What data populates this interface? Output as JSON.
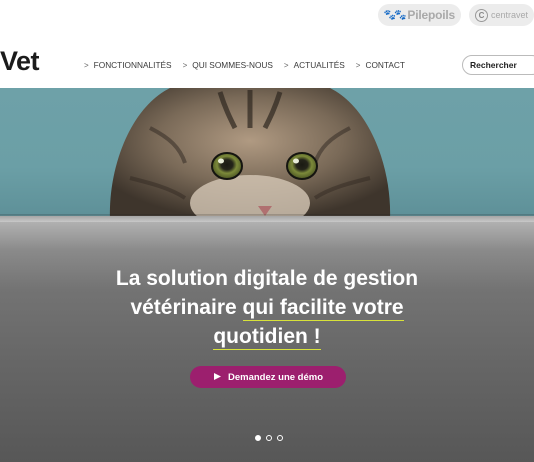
{
  "partners": {
    "pilepoils": "Pilepoils",
    "centravet": "centravet",
    "paw_icons": "🐾🐾"
  },
  "header": {
    "logo": "Vet",
    "nav": [
      {
        "label": "FONCTIONNALITÉS"
      },
      {
        "label": "QUI SOMMES-NOUS"
      },
      {
        "label": "ACTUALITÉS"
      },
      {
        "label": "CONTACT"
      }
    ],
    "chevron": ">",
    "search_placeholder": "Rechercher"
  },
  "hero": {
    "title_line1": "La solution digitale de gestion",
    "title_line2_a": "vétérinaire ",
    "title_line2_b": "qui facilite votre",
    "title_line3": "quotidien !",
    "highlight_color": "#d8e23a",
    "cta_label": "Demandez une démo",
    "cta_color": "#9c1f6e",
    "slides_count": 3,
    "active_slide": 1
  },
  "colors": {
    "wall": "#6ea1a8",
    "text_dark": "#1b1b1b"
  }
}
